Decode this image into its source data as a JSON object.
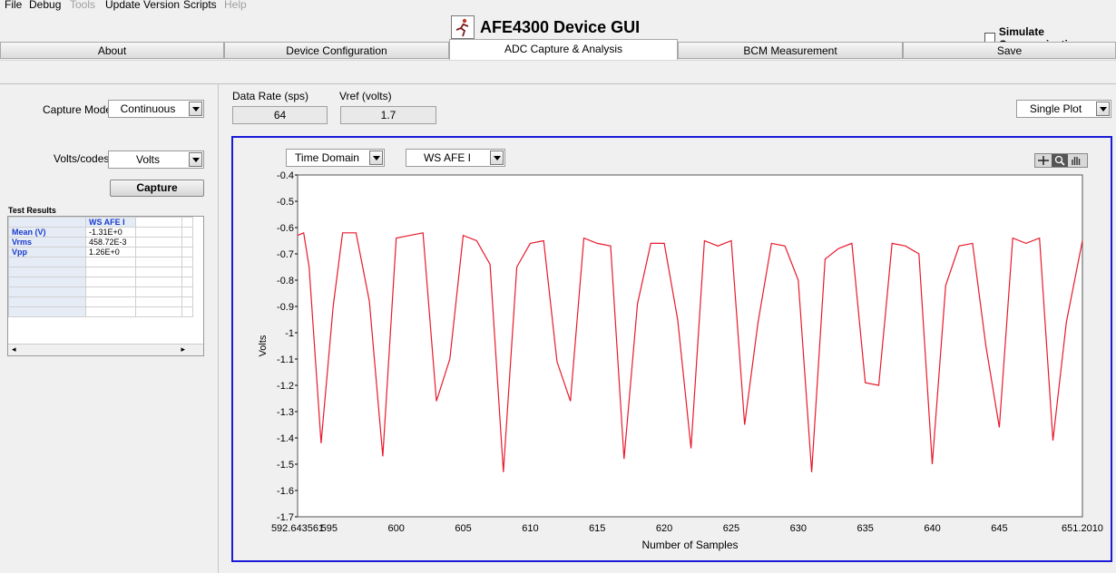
{
  "menu": {
    "items": [
      {
        "label": "File",
        "enabled": true
      },
      {
        "label": "Debug",
        "enabled": true
      },
      {
        "label": "Tools",
        "enabled": false
      },
      {
        "label": "Update Version",
        "enabled": true
      },
      {
        "label": "Scripts",
        "enabled": true
      },
      {
        "label": "Help",
        "enabled": false
      }
    ]
  },
  "app": {
    "title": "AFE4300 Device GUI",
    "simulate_label": "Simulate Communication",
    "simulate_checked": false
  },
  "tabs": [
    {
      "label": "About",
      "active": false
    },
    {
      "label": "Device Configuration",
      "active": false
    },
    {
      "label": "ADC Capture & Analysis",
      "active": true
    },
    {
      "label": "BCM Measurement",
      "active": false
    },
    {
      "label": "Save",
      "active": false
    }
  ],
  "left": {
    "capture_mode_label": "Capture Mode",
    "capture_mode_value": "Continuous",
    "volts_codes_label": "Volts/codes",
    "volts_codes_value": "Volts",
    "capture_button": "Capture",
    "test_results_label": "Test Results",
    "results_table": {
      "column_header": "WS AFE I",
      "rows": [
        {
          "name": "Mean (V)",
          "value": "-1.31E+0"
        },
        {
          "name": "Vrms",
          "value": "458.72E-3"
        },
        {
          "name": "Vpp",
          "value": "1.26E+0"
        }
      ]
    }
  },
  "top": {
    "data_rate_label": "Data Rate (sps)",
    "data_rate_value": "64",
    "vref_label": "Vref (volts)",
    "vref_value": "1.7",
    "plot_mode_value": "Single Plot"
  },
  "graph": {
    "domain_value": "Time Domain",
    "channel_value": "WS AFE I",
    "tool_icons": [
      "crosshair-icon",
      "zoom-icon",
      "pan-hand-icon"
    ],
    "line_color": "#e8192c"
  },
  "chart_data": {
    "type": "line",
    "xlabel": "Number of Samples",
    "ylabel": "Volts",
    "xlim": [
      592.643561,
      651.201
    ],
    "ylim": [
      -1.7,
      -0.4
    ],
    "x_tick_labels": [
      "592.643561",
      "595",
      "600",
      "605",
      "610",
      "615",
      "620",
      "625",
      "630",
      "635",
      "640",
      "645",
      "651.2010"
    ],
    "x_ticks": [
      595,
      600,
      605,
      610,
      615,
      620,
      625,
      630,
      635,
      640,
      645
    ],
    "y_ticks": [
      -0.4,
      -0.5,
      -0.6,
      -0.7,
      -0.8,
      -0.9,
      -1,
      -1.1,
      -1.2,
      -1.3,
      -1.4,
      -1.5,
      -1.6,
      -1.7
    ],
    "y_tick_labels": [
      "-0.4",
      "-0.5",
      "-0.6",
      "-0.7",
      "-0.8",
      "-0.9",
      "-1",
      "-1.1",
      "-1.2",
      "-1.3",
      "-1.4",
      "-1.5",
      "-1.6",
      "-1.7"
    ],
    "grid": true,
    "series": [
      {
        "values": [
          [
            592.64,
            -0.63
          ],
          [
            593.1,
            -0.62
          ],
          [
            593.5,
            -0.75
          ],
          [
            594.4,
            -1.42
          ],
          [
            595.3,
            -0.9
          ],
          [
            596,
            -0.62
          ],
          [
            597,
            -0.62
          ],
          [
            598,
            -0.88
          ],
          [
            599,
            -1.47
          ],
          [
            600,
            -0.64
          ],
          [
            601,
            -0.63
          ],
          [
            602,
            -0.62
          ],
          [
            603,
            -1.26
          ],
          [
            604,
            -1.1
          ],
          [
            605,
            -0.63
          ],
          [
            606,
            -0.65
          ],
          [
            607,
            -0.74
          ],
          [
            608,
            -1.53
          ],
          [
            609,
            -0.75
          ],
          [
            610,
            -0.66
          ],
          [
            611,
            -0.65
          ],
          [
            612,
            -1.11
          ],
          [
            613,
            -1.26
          ],
          [
            614,
            -0.64
          ],
          [
            615,
            -0.66
          ],
          [
            616,
            -0.67
          ],
          [
            617,
            -1.48
          ],
          [
            618,
            -0.89
          ],
          [
            619,
            -0.66
          ],
          [
            620,
            -0.66
          ],
          [
            621,
            -0.95
          ],
          [
            622,
            -1.44
          ],
          [
            623,
            -0.65
          ],
          [
            624,
            -0.67
          ],
          [
            625,
            -0.65
          ],
          [
            626,
            -1.35
          ],
          [
            627,
            -0.96
          ],
          [
            628,
            -0.66
          ],
          [
            629,
            -0.67
          ],
          [
            630,
            -0.8
          ],
          [
            631,
            -1.53
          ],
          [
            632,
            -0.72
          ],
          [
            633,
            -0.68
          ],
          [
            634,
            -0.66
          ],
          [
            635,
            -1.19
          ],
          [
            636,
            -1.2
          ],
          [
            637,
            -0.66
          ],
          [
            638,
            -0.67
          ],
          [
            639,
            -0.7
          ],
          [
            640,
            -1.5
          ],
          [
            641,
            -0.82
          ],
          [
            642,
            -0.67
          ],
          [
            643,
            -0.66
          ],
          [
            644,
            -1.05
          ],
          [
            645,
            -1.36
          ],
          [
            646,
            -0.64
          ],
          [
            647,
            -0.66
          ],
          [
            648,
            -0.64
          ],
          [
            649,
            -1.41
          ],
          [
            650,
            -0.96
          ],
          [
            651.2,
            -0.65
          ]
        ]
      }
    ]
  }
}
